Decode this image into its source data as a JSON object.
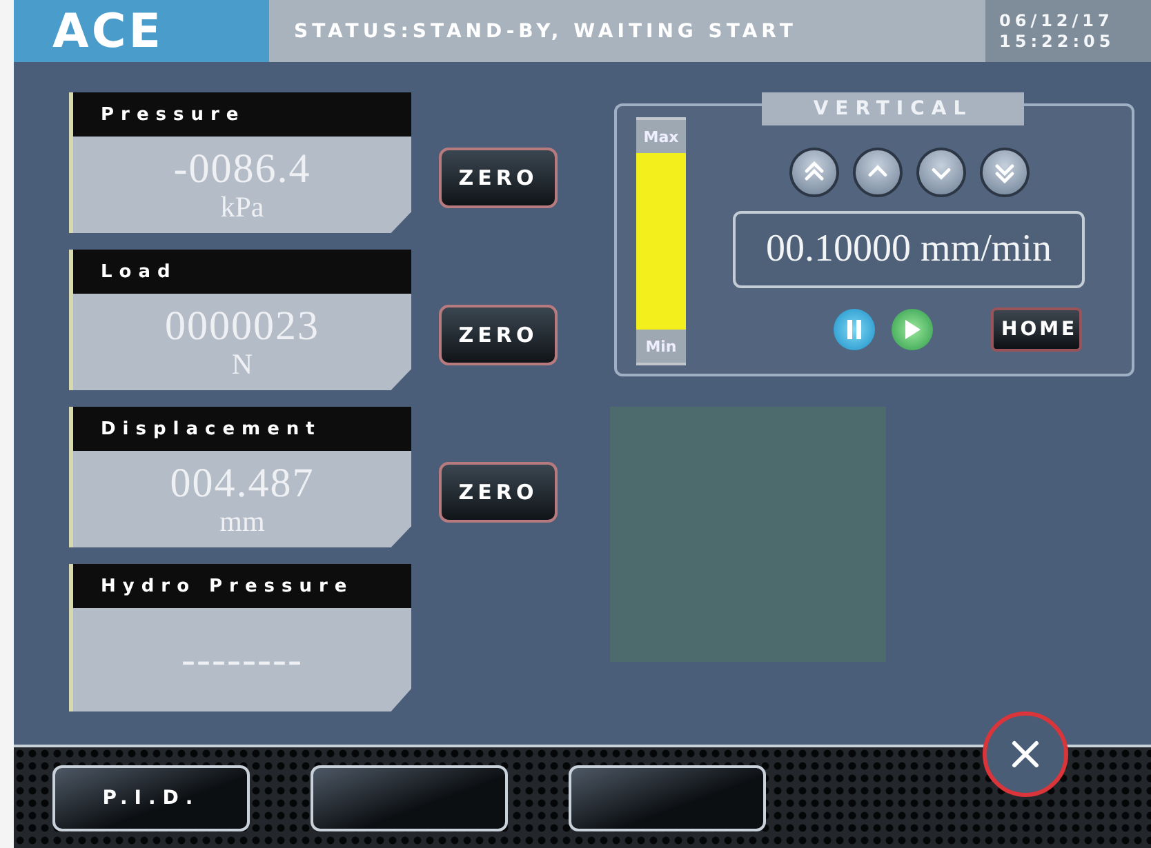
{
  "header": {
    "logo": "ACE",
    "status": "STATUS:STAND-BY, WAITING START",
    "date": "06/12/17",
    "time": "15:22:05"
  },
  "readouts": [
    {
      "label": "Pressure",
      "value": "-0086.4",
      "unit": "kPa",
      "zero_button": "ZERO"
    },
    {
      "label": "Load",
      "value": "0000023",
      "unit": "N",
      "zero_button": "ZERO"
    },
    {
      "label": "Displacement",
      "value": "004.487",
      "unit": "mm",
      "zero_button": "ZERO"
    },
    {
      "label": "Hydro Pressure",
      "value": "--------"
    }
  ],
  "vertical": {
    "title": "VERTICAL",
    "gauge": {
      "max_label": "Max",
      "min_label": "Min",
      "level": 1
    },
    "jog_buttons": [
      {
        "kind": "fast-up"
      },
      {
        "kind": "up"
      },
      {
        "kind": "down"
      },
      {
        "kind": "fast-down"
      }
    ],
    "speed": "00.10000 mm/min",
    "run_buttons": [
      {
        "kind": "pause"
      },
      {
        "kind": "play"
      }
    ],
    "home_button": "HOME"
  },
  "footer": {
    "buttons": [
      {
        "kind": "labeled",
        "label": "P.I.D."
      },
      {
        "kind": "blank"
      },
      {
        "kind": "blank"
      }
    ]
  }
}
